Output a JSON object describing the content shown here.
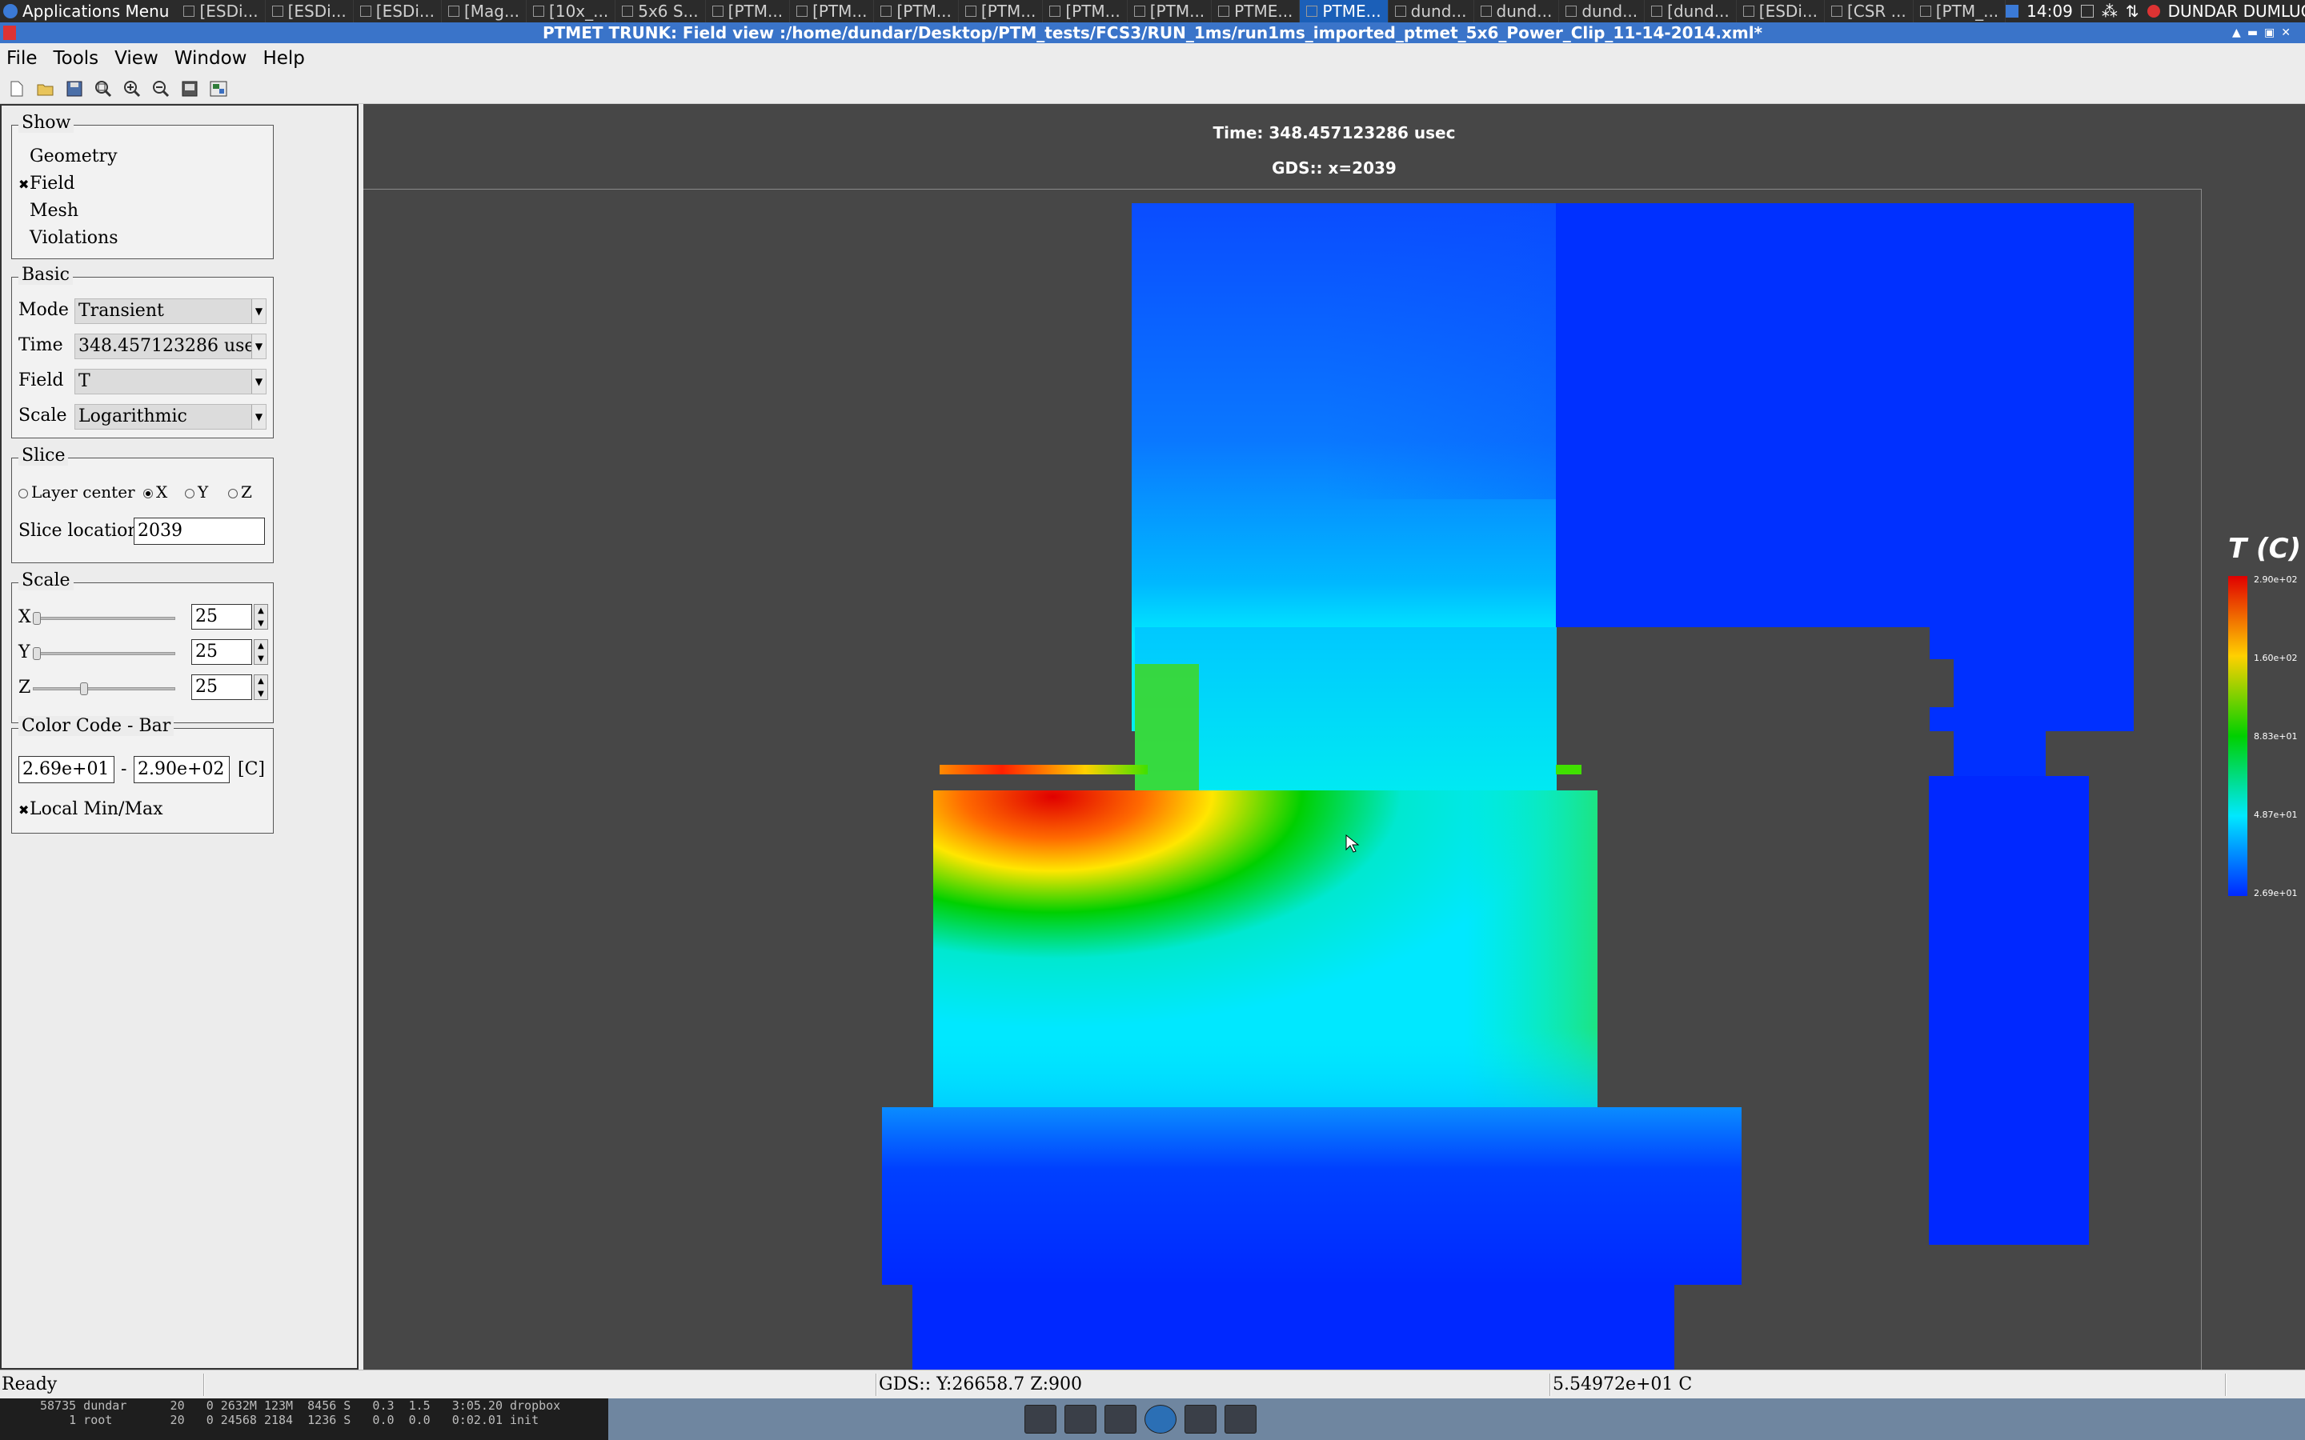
{
  "top_panel": {
    "apps_menu": "Applications Menu",
    "tasks": [
      "[ESDi...",
      "[ESDi...",
      "[ESDi...",
      "[Mag...",
      "[10x_...",
      "5x6 S...",
      "[PTM...",
      "[PTM...",
      "[PTM...",
      "[PTM...",
      "[PTM...",
      "[PTM...",
      "PTME...",
      "PTME...",
      "dund...",
      "dund...",
      "dund...",
      "[dund...",
      "[ESDi...",
      "[CSR ...",
      "[PTM_..."
    ],
    "active_task_index": 13,
    "clock": "14:09",
    "user": "DUNDAR DUMLUGOL PRO"
  },
  "window": {
    "title": "PTMET TRUNK: Field view :/home/dundar/Desktop/PTM_tests/FCS3/RUN_1ms/run1ms_imported_ptmet_5x6_Power_Clip_11-14-2014.xml*"
  },
  "menu": [
    "File",
    "Tools",
    "View",
    "Window",
    "Help"
  ],
  "toolbar_icons": [
    "new-file-icon",
    "open-folder-icon",
    "save-icon",
    "zoom-fit-icon",
    "zoom-in-icon",
    "zoom-out-icon",
    "export-icon",
    "screenshot-icon"
  ],
  "panel": {
    "show": {
      "title": "Show",
      "options": [
        {
          "label": "Geometry",
          "checked": false
        },
        {
          "label": "Field",
          "checked": true
        },
        {
          "label": "Mesh",
          "checked": false
        },
        {
          "label": "Violations",
          "checked": false
        }
      ]
    },
    "basic": {
      "title": "Basic",
      "mode_label": "Mode",
      "mode_value": "Transient",
      "time_label": "Time",
      "time_value": "348.457123286 usec",
      "field_label": "Field",
      "field_value": "T",
      "scale_label": "Scale",
      "scale_value": "Logarithmic"
    },
    "slice": {
      "title": "Slice",
      "options": [
        "Layer center",
        "X",
        "Y",
        "Z"
      ],
      "selected": "X",
      "location_label": "Slice location",
      "location_value": "2039"
    },
    "scale": {
      "title": "Scale",
      "x_label": "X",
      "x_value": "25",
      "x_level": 0.0,
      "y_label": "Y",
      "y_value": "25",
      "y_level": 0.0,
      "z_label": "Z",
      "z_value": "25",
      "z_level": 0.35
    },
    "color_code": {
      "title": "Color Code - Bar",
      "min": "2.69e+01",
      "dash": "-",
      "max": "2.90e+02",
      "unit": "[C]",
      "local_minmax_label": "Local Min/Max",
      "local_minmax_checked": true
    }
  },
  "viewport": {
    "time_text": "Time: 348.457123286 usec",
    "gds_text": "GDS:: x=2039",
    "colors": {
      "background": "#474747",
      "deep_blue": "#0028ff",
      "cyan": "#00e8ff",
      "green": "#00d000",
      "yellow": "#ffe600",
      "red": "#e00000"
    }
  },
  "legend": {
    "title": "T (C)",
    "ticks": [
      "2.90e+02",
      "1.60e+02",
      "8.83e+01",
      "4.87e+01",
      "2.69e+01"
    ]
  },
  "status": {
    "ready": "Ready",
    "gds": "GDS:: Y:26658.7 Z:900",
    "value": "5.54972e+01 C"
  },
  "terminal_lines": [
    "58735 dundar      20   0 2632M 123M  8456 S   0.3  1.5   3:05.20 dropbox",
    "    1 root        20   0 24568 2184  1236 S   0.0  0.0   0:02.01 init"
  ]
}
